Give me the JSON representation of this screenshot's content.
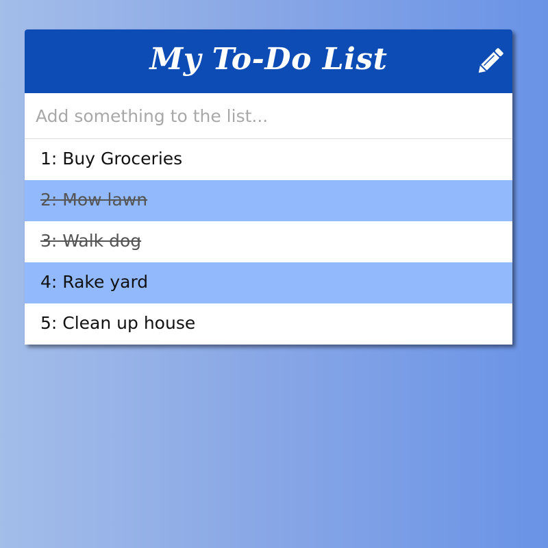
{
  "app": {
    "title": "My To-Do List",
    "edit_icon": "pencil-icon"
  },
  "input": {
    "placeholder": "Add something to the list...",
    "value": ""
  },
  "items": [
    {
      "label": "1: Buy Groceries",
      "completed": false
    },
    {
      "label": "2: Mow lawn",
      "completed": true
    },
    {
      "label": "3: Walk dog",
      "completed": true
    },
    {
      "label": "4: Rake yard",
      "completed": false
    },
    {
      "label": "5: Clean up house",
      "completed": false
    }
  ],
  "colors": {
    "header": "#0d4bb5",
    "alt_row": "#92b9fc",
    "background_start": "#a3bde9",
    "background_end": "#6a93e6"
  }
}
